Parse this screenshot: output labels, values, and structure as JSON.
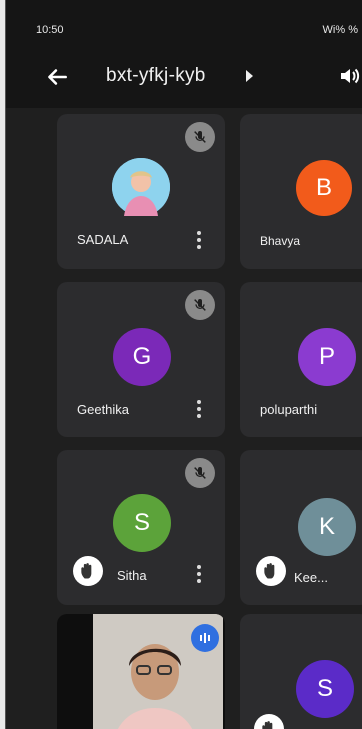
{
  "status_bar": {
    "time": "10:50",
    "right_text": "Wi% %"
  },
  "meeting": {
    "code": "bxt-yfkj-kyb"
  },
  "participants": [
    {
      "name": "SADALA",
      "initial": "",
      "color": "#7fc9e8"
    },
    {
      "name": "Bhavya",
      "initial": "B",
      "color": "#f25b1b"
    },
    {
      "name": "Geethika",
      "initial": "G",
      "color": "#7b29b8"
    },
    {
      "name": "poluparthi",
      "initial": "P",
      "color": "#8b3bd0"
    },
    {
      "name": "Sitha",
      "initial": "S",
      "color": "#5ca33a"
    },
    {
      "name": "Kee...",
      "initial": "K",
      "color": "#6f8f99"
    },
    {
      "name": "",
      "initial": "S",
      "color": "#5b2bc8"
    }
  ]
}
